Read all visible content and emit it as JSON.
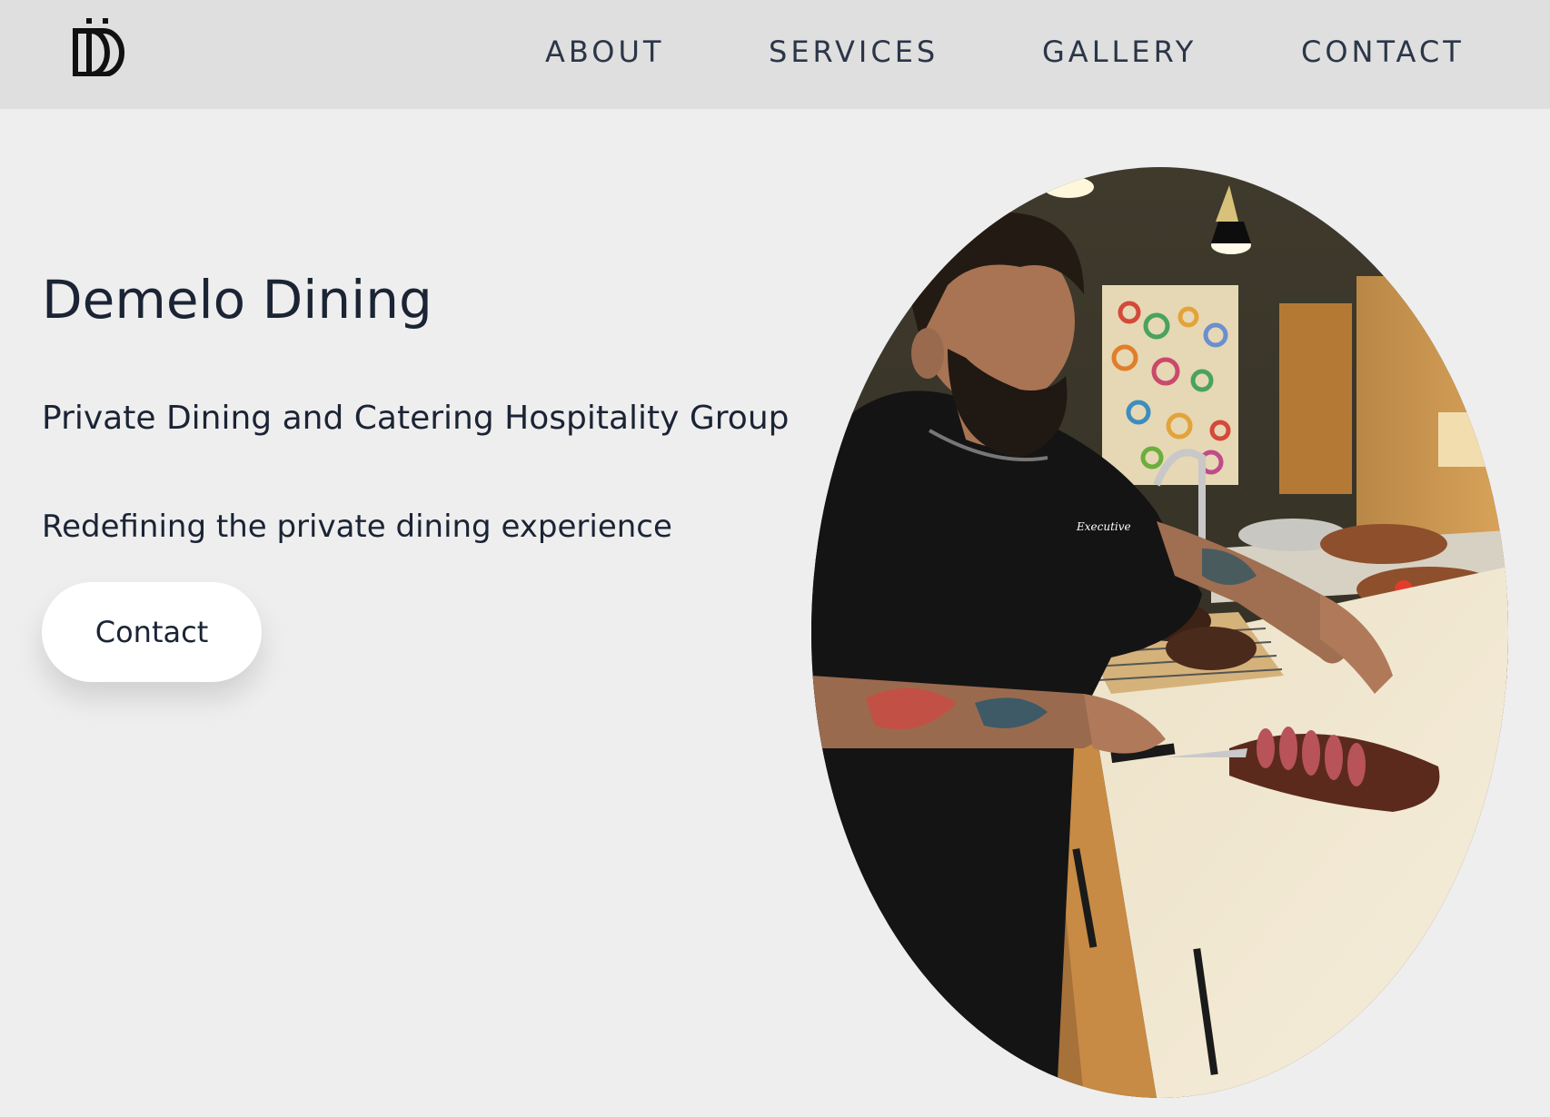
{
  "header": {
    "logo_icon": "dd-monogram-logo-icon",
    "nav": {
      "about": "ABOUT",
      "services": "SERVICES",
      "gallery": "GALLERY",
      "contact": "CONTACT"
    }
  },
  "hero": {
    "title": "Demelo Dining",
    "tagline": "Private Dining and Catering Hospitality Group",
    "subline": "Redefining the private dining experience",
    "cta_label": "Contact",
    "photo_description_icon": "chef-slicing-steak-photo"
  },
  "colors": {
    "page_bg": "#eeeeee",
    "header_bg": "#dfdfdf",
    "text": "#1b2435",
    "button_bg": "#ffffff"
  }
}
